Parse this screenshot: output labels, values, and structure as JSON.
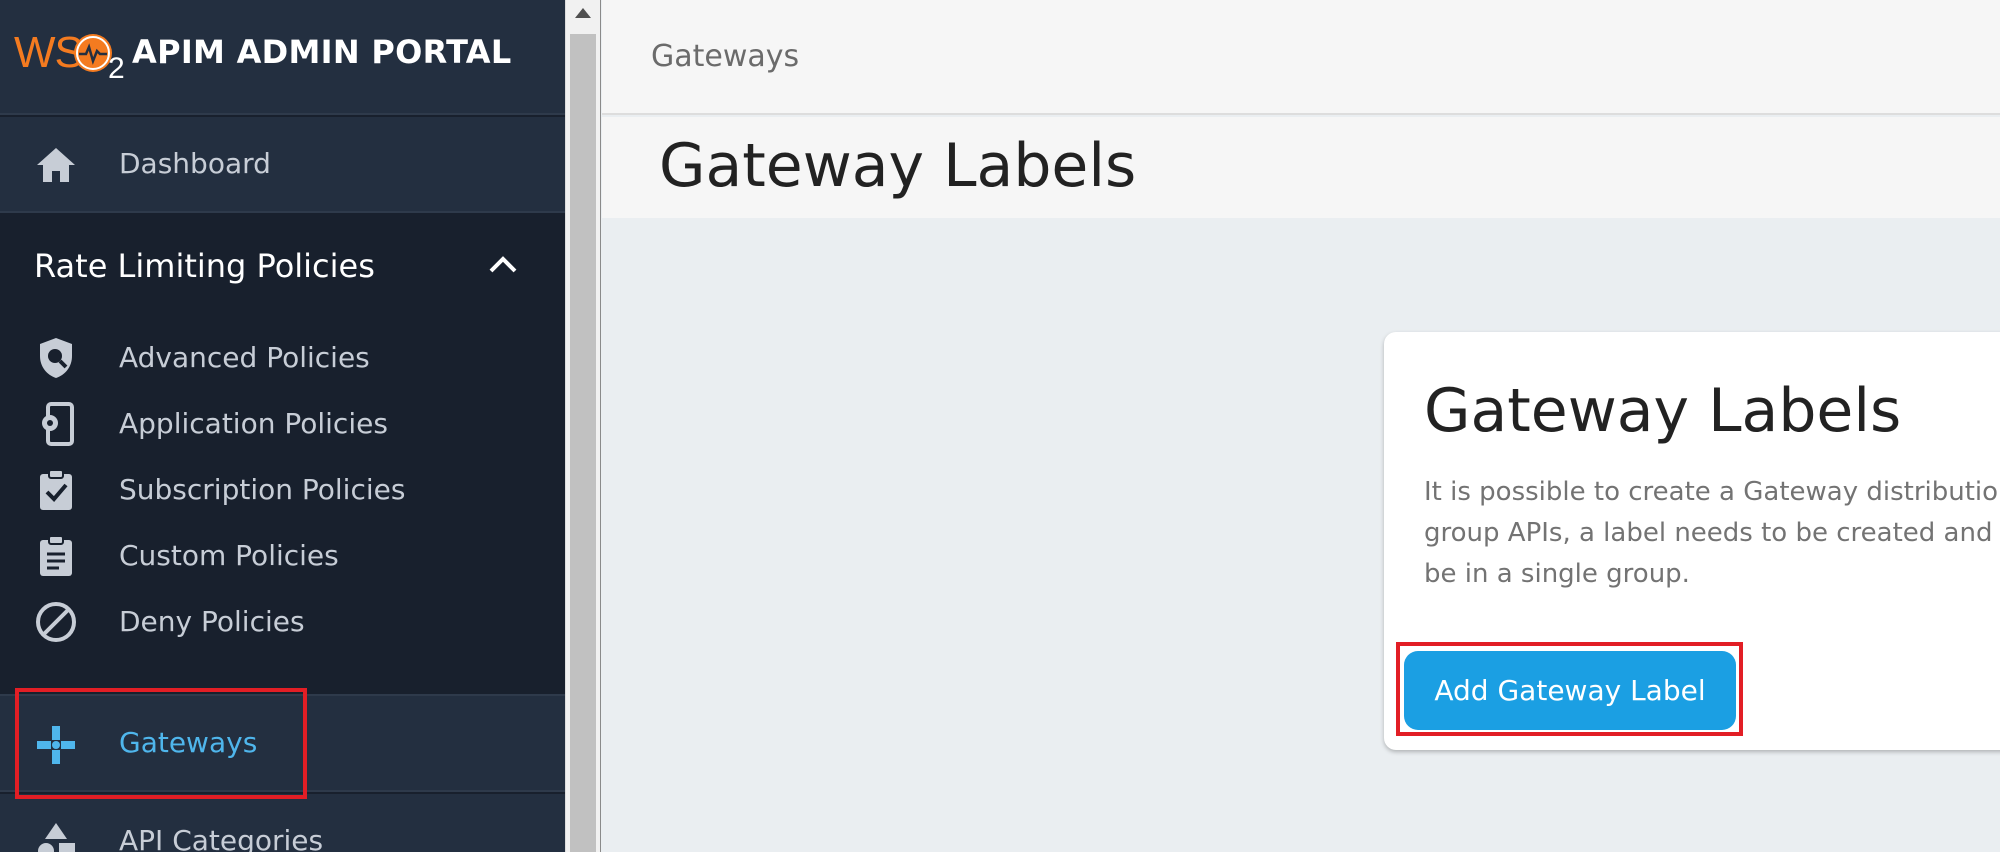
{
  "app": {
    "logo_text": "WS",
    "logo_sub": "2",
    "title": "APIM ADMIN PORTAL"
  },
  "sidebar": {
    "dashboard": {
      "label": "Dashboard",
      "icon": "home-icon"
    },
    "rate_section": {
      "label": "Rate Limiting Policies",
      "icon": "chevron-up-icon"
    },
    "policies": [
      {
        "label": "Advanced Policies",
        "icon": "shield-search-icon"
      },
      {
        "label": "Application Policies",
        "icon": "phone-gear-icon"
      },
      {
        "label": "Subscription Policies",
        "icon": "clipboard-check-icon"
      },
      {
        "label": "Custom Policies",
        "icon": "clipboard-list-icon"
      },
      {
        "label": "Deny Policies",
        "icon": "block-icon"
      }
    ],
    "gateways": {
      "label": "Gateways",
      "icon": "gateways-icon"
    },
    "categories": {
      "label": "API Categories",
      "icon": "categories-icon"
    }
  },
  "header": {
    "breadcrumb": "Gateways",
    "title": "Gateway Labels"
  },
  "card": {
    "title": "Gateway Labels",
    "description_lines": [
      "It is possible to create a Gateway distributio",
      "group APIs, a label needs to be created and",
      "be in a single group."
    ],
    "button_label": "Add Gateway Label"
  },
  "colors": {
    "sidebar_bg": "#18202d",
    "sidebar_header_bg": "#232f40",
    "accent_blue": "#1b9fe3",
    "active_text": "#4fb6ec",
    "brand_orange": "#f47b20",
    "highlight_red": "#e21e25"
  }
}
